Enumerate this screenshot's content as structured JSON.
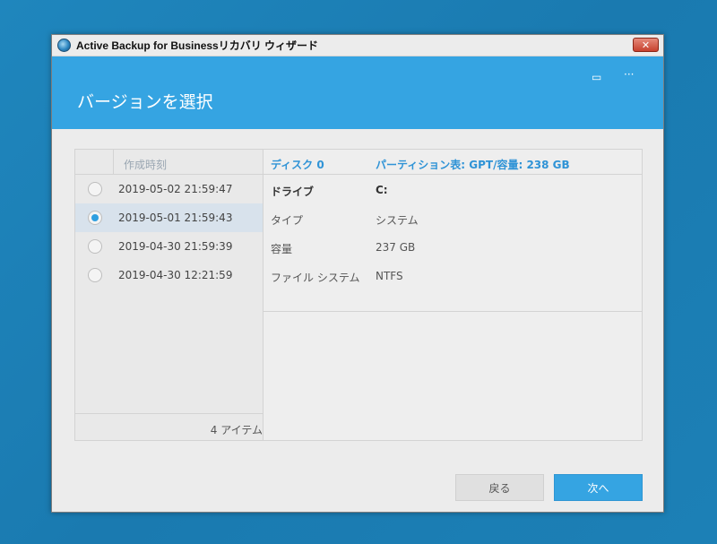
{
  "window": {
    "title": "Active Backup for Businessリカバリ ウィザード",
    "close_label": "✕"
  },
  "header": {
    "title": "バージョンを選択",
    "icons": [
      "monitor-icon",
      "more-icon"
    ],
    "more_glyph": "···",
    "monitor_glyph": "▭"
  },
  "versions": {
    "column_header": "作成時刻",
    "items": [
      {
        "date": "2019-05-02 21:59:47",
        "selected": false
      },
      {
        "date": "2019-05-01 21:59:43",
        "selected": true
      },
      {
        "date": "2019-04-30 21:59:39",
        "selected": false
      },
      {
        "date": "2019-04-30 12:21:59",
        "selected": false
      }
    ],
    "count_label": "4 アイテム"
  },
  "disk": {
    "name": "ディスク 0",
    "partition_info": "パーティション表: GPT/容量: 238 GB",
    "rows": [
      {
        "key": "ドライブ",
        "value": "C:"
      },
      {
        "key": "タイプ",
        "value": "システム"
      },
      {
        "key": "容量",
        "value": "237 GB"
      },
      {
        "key": "ファイル システム",
        "value": "NTFS"
      }
    ]
  },
  "buttons": {
    "back": "戻る",
    "next": "次へ"
  },
  "colors": {
    "accent": "#35a4e2",
    "desktop": "#1f86bd"
  }
}
